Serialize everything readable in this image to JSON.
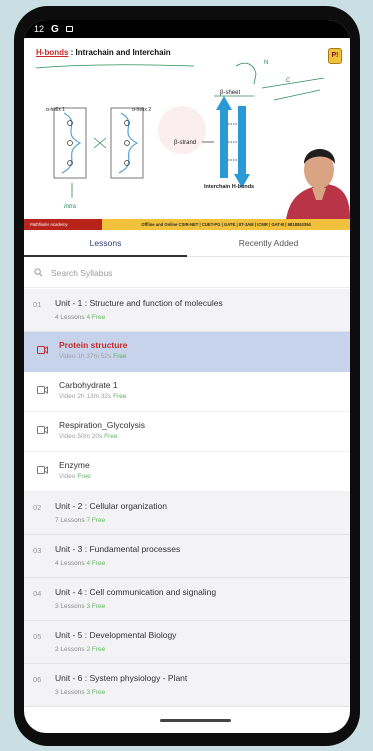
{
  "status": {
    "time": "12",
    "g_label": "G"
  },
  "video": {
    "title_prefix": "H-bonds",
    "title_rest": ": Intrachain and Interchain",
    "labels": {
      "helix1": "α-helix 1",
      "helix2": "α-helix 2",
      "strand": "β-strand",
      "sheet": "β-sheet",
      "interchain": "Interchain H-bonds",
      "n": "N",
      "c": "C",
      "intra": "Intra"
    },
    "logo": "P!"
  },
  "banner": {
    "brand": "Pathfinder Academy",
    "tagline": "Offline and Online CSIR-NET | CUET-PG | GATE | IIT-JAM | ICMR | GAT-B | 9818063394"
  },
  "tabs": [
    {
      "label": "Lessons",
      "active": true
    },
    {
      "label": "Recently Added",
      "active": false
    }
  ],
  "search": {
    "placeholder": "Search Syllabus"
  },
  "units": [
    {
      "num": "01",
      "name": "Unit - 1 : Structure and function of molecules",
      "lessons": "4 Lessons",
      "free": "4 Free",
      "expanded": true,
      "items": [
        {
          "title": "Protein structure",
          "type": "Video",
          "duration": "1h 37m 52s",
          "free": "Free",
          "active": true
        },
        {
          "title": "Carbohydrate 1",
          "type": "Video",
          "duration": "2h 13m 32s",
          "free": "Free",
          "active": false
        },
        {
          "title": "Respiration_Glycolysis",
          "type": "Video",
          "duration": "50m 20s",
          "free": "Free",
          "active": false
        },
        {
          "title": "Enzyme",
          "type": "Video",
          "duration": "",
          "free": "Free",
          "active": false
        }
      ]
    },
    {
      "num": "02",
      "name": "Unit - 2 : Cellular organization",
      "lessons": "7 Lessons",
      "free": "7 Free"
    },
    {
      "num": "03",
      "name": "Unit - 3 : Fundamental processes",
      "lessons": "4 Lessons",
      "free": "4 Free"
    },
    {
      "num": "04",
      "name": "Unit - 4 : Cell communication and signaling",
      "lessons": "3 Lessons",
      "free": "3 Free"
    },
    {
      "num": "05",
      "name": "Unit - 5 : Developmental Biology",
      "lessons": "2 Lessons",
      "free": "2 Free"
    },
    {
      "num": "06",
      "name": "Unit - 6 : System physiology - Plant",
      "lessons": "3 Lessons",
      "free": "3 Free"
    }
  ],
  "colors": {
    "accent": "#c62a2a",
    "active_row": "#c7d3eb",
    "free": "#5fb85f",
    "tab_active": "#2e3d72"
  },
  "icons": {
    "lesson": "video-camera-icon",
    "search": "search-icon"
  }
}
